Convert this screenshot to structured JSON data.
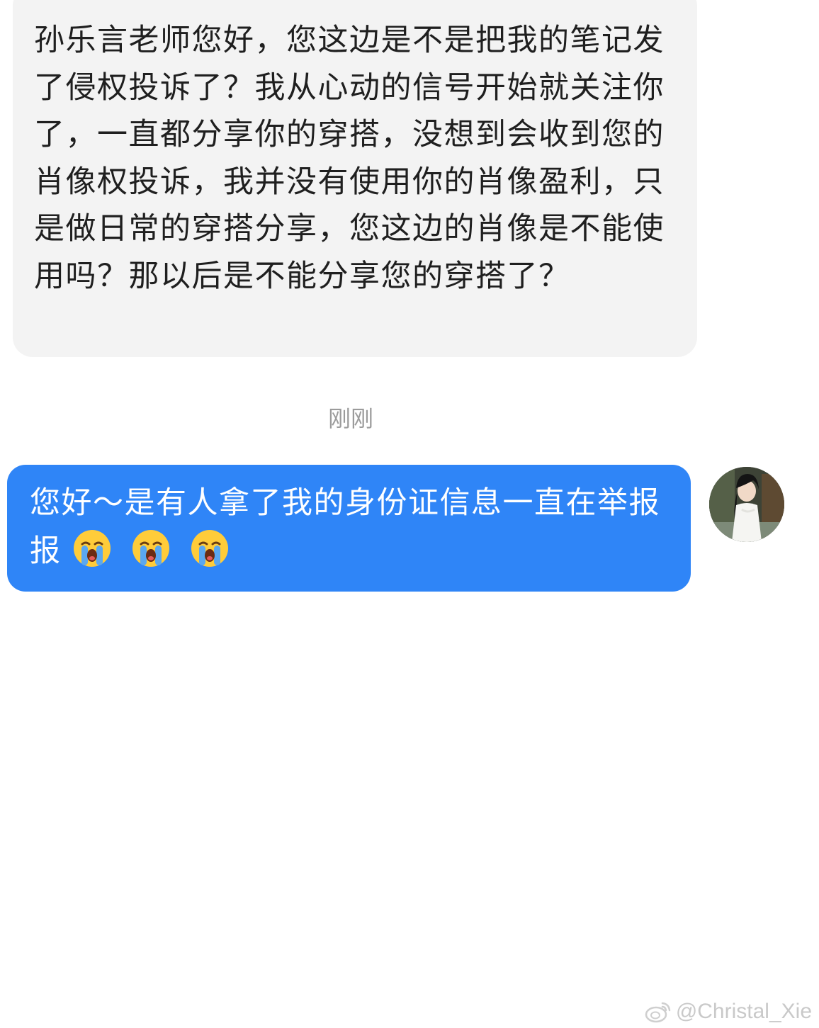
{
  "conversation": {
    "incoming_message": {
      "text": "孙乐言老师您好，您这边是不是把我的笔记发了侵权投诉了？我从心动的信号开始就关注你了，一直都分享你的穿搭，没想到会收到您的肖像权投诉，我并没有使用你的肖像盈利，只是做日常的穿搭分享，您这边的肖像是不能使用吗？那以后是不能分享您的穿搭了？"
    },
    "timestamp": "刚刚",
    "outgoing_message": {
      "text": "您好～是有人拿了我的身份证信息一直在举报",
      "emojis": [
        "loudly-crying-face",
        "loudly-crying-face",
        "loudly-crying-face"
      ]
    },
    "avatar": {
      "icon": "user-avatar"
    }
  },
  "watermark": {
    "text": "@Christal_Xie",
    "icon": "weibo-icon"
  },
  "colors": {
    "incoming_bubble": "#f3f3f3",
    "outgoing_bubble": "#2f85f7",
    "timestamp": "#9b9b9b"
  }
}
